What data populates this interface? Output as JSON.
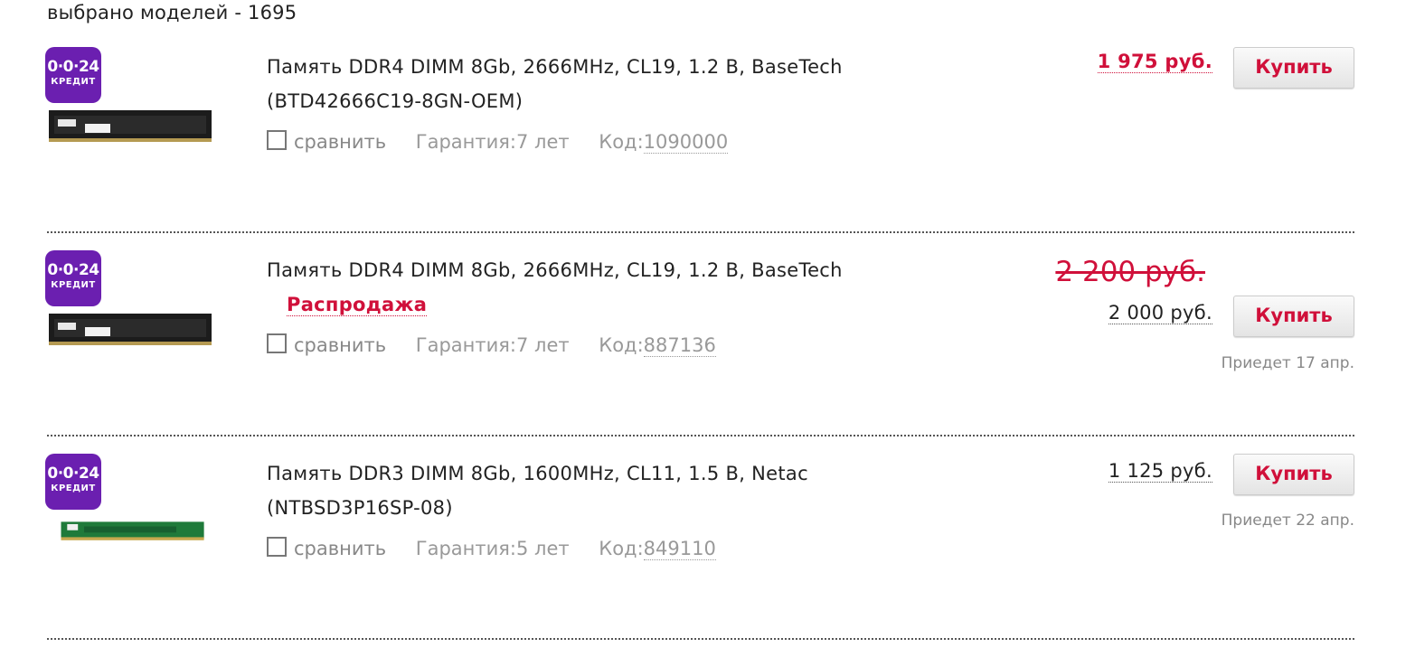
{
  "summary": "выбрано моделей - 1695",
  "credit_badge": {
    "line1": "0·0·24",
    "line2": "КРЕДИТ"
  },
  "compare_label": "сравнить",
  "buy_label": "Купить",
  "colors": {
    "accent": "#d0103a",
    "badge": "#6b1fb0"
  },
  "products": [
    {
      "title": "Память DDR4 DIMM 8Gb, 2666MHz, CL19, 1.2 В, BaseTech (BTD42666C19-8GN-OEM)",
      "warranty": "Гарантия:7 лет",
      "code_label": "Код:",
      "code": "1090000",
      "price": "1 975 руб.",
      "old_price": "",
      "sale": "",
      "arrival": ""
    },
    {
      "title": "Память DDR4 DIMM 8Gb, 2666MHz, CL19, 1.2 В, BaseTech",
      "warranty": "Гарантия:7 лет",
      "code_label": "Код:",
      "code": "887136",
      "price": "2 000 руб.",
      "old_price": "2 200 руб.",
      "sale": "Распродажа",
      "arrival": "Приедет 17 апр."
    },
    {
      "title": "Память DDR3 DIMM 8Gb, 1600MHz, CL11, 1.5 В, Netac (NTBSD3P16SP-08)",
      "warranty": "Гарантия:5 лет",
      "code_label": "Код:",
      "code": "849110",
      "price": "1 125 руб.",
      "old_price": "",
      "sale": "",
      "arrival": "Приедет 22 апр."
    }
  ]
}
